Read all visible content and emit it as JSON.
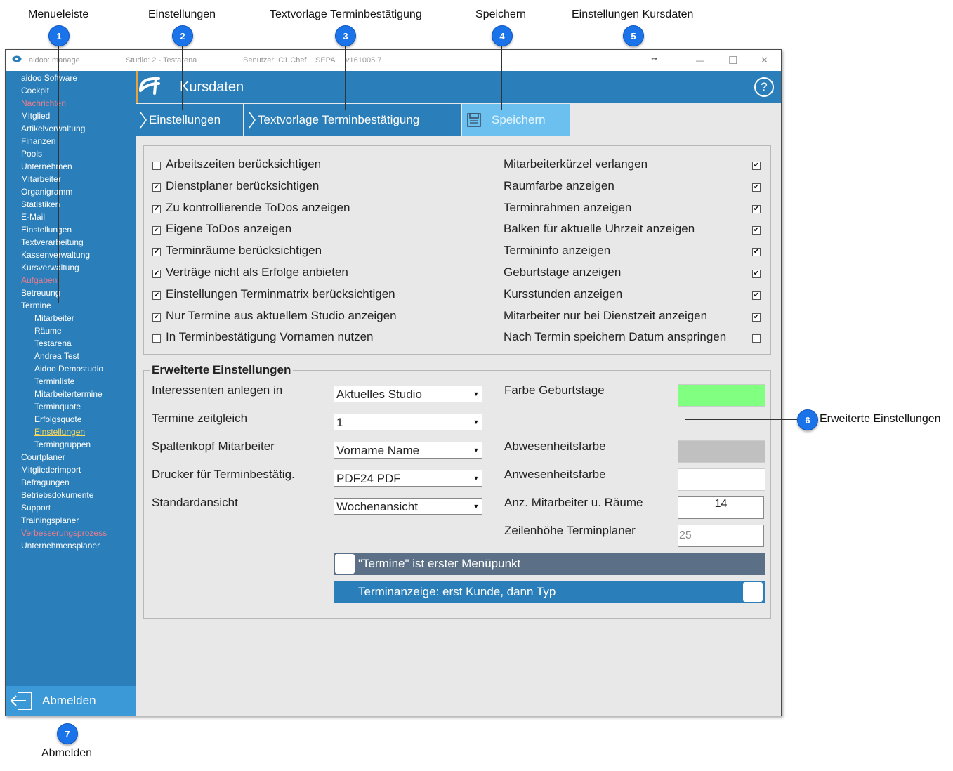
{
  "callouts": [
    {
      "num": "1",
      "label": "Menueleiste"
    },
    {
      "num": "2",
      "label": "Einstellungen"
    },
    {
      "num": "3",
      "label": "Textvorlage Terminbestätigung"
    },
    {
      "num": "4",
      "label": "Speichern"
    },
    {
      "num": "5",
      "label": "Einstellungen Kursdaten"
    },
    {
      "num": "6",
      "label": "Erweiterte Einstellungen"
    },
    {
      "num": "7",
      "label": "Abmelden"
    }
  ],
  "titlebar": {
    "app": "aidoo::manage",
    "studio": "Studio: 2 - Testarena",
    "user": "Benutzer: C1 Chef",
    "sepa": "SEPA",
    "version": "v161005.7",
    "resize_glyph": "↔",
    "min_glyph": "—",
    "max_glyph": "☐",
    "close_glyph": "✕"
  },
  "sidebar": {
    "items": [
      {
        "label": "aidoo Software",
        "style": "normal"
      },
      {
        "label": "Cockpit",
        "style": "normal"
      },
      {
        "label": "Nachrichten",
        "style": "red"
      },
      {
        "label": "Mitglied",
        "style": "normal"
      },
      {
        "label": "Artikelverwaltung",
        "style": "normal"
      },
      {
        "label": "Finanzen",
        "style": "normal"
      },
      {
        "label": "Pools",
        "style": "normal"
      },
      {
        "label": "Unternehmen",
        "style": "normal"
      },
      {
        "label": "Mitarbeiter",
        "style": "normal"
      },
      {
        "label": "Organigramm",
        "style": "normal"
      },
      {
        "label": "Statistiken",
        "style": "normal"
      },
      {
        "label": "E-Mail",
        "style": "normal"
      },
      {
        "label": "Einstellungen",
        "style": "normal"
      },
      {
        "label": "Textverarbeitung",
        "style": "normal"
      },
      {
        "label": "Kassenverwaltung",
        "style": "normal"
      },
      {
        "label": "Kursverwaltung",
        "style": "normal"
      },
      {
        "label": "Aufgaben",
        "style": "red"
      },
      {
        "label": "Betreuung",
        "style": "normal"
      },
      {
        "label": "Termine",
        "style": "normal"
      },
      {
        "label": "Mitarbeiter",
        "style": "sub"
      },
      {
        "label": "Räume",
        "style": "sub"
      },
      {
        "label": "Testarena",
        "style": "sub"
      },
      {
        "label": "Andrea Test",
        "style": "sub"
      },
      {
        "label": "Aidoo Demostudio",
        "style": "sub"
      },
      {
        "label": "Terminliste",
        "style": "sub"
      },
      {
        "label": "Mitarbeitertermine",
        "style": "sub"
      },
      {
        "label": "Terminquote",
        "style": "sub"
      },
      {
        "label": "Erfolgsquote",
        "style": "sub"
      },
      {
        "label": "Einstellungen",
        "style": "sub-active"
      },
      {
        "label": "Termingruppen",
        "style": "sub"
      },
      {
        "label": "Courtplaner",
        "style": "normal"
      },
      {
        "label": "Mitgliederimport",
        "style": "normal"
      },
      {
        "label": "Befragungen",
        "style": "normal"
      },
      {
        "label": "Betriebsdokumente",
        "style": "normal"
      },
      {
        "label": "Support",
        "style": "normal"
      },
      {
        "label": "Trainingsplaner",
        "style": "normal"
      },
      {
        "label": "Verbesserungsprozess",
        "style": "red"
      },
      {
        "label": "Unternehmensplaner",
        "style": "normal"
      }
    ],
    "logout_label": "Abmelden"
  },
  "header": {
    "title": "Kursdaten",
    "help": "?"
  },
  "tabs": {
    "einstellungen": "Einstellungen",
    "textvorlage": "Textvorlage Terminbestätigung",
    "speichern": "Speichern"
  },
  "checks_left": [
    {
      "label": "Arbeitszeiten berücksichtigen",
      "checked": false
    },
    {
      "label": "Dienstplaner berücksichtigen",
      "checked": true
    },
    {
      "label": "Zu kontrollierende ToDos anzeigen",
      "checked": true
    },
    {
      "label": "Eigene ToDos anzeigen",
      "checked": true
    },
    {
      "label": "Terminräume berücksichtigen",
      "checked": true
    },
    {
      "label": "Verträge nicht als Erfolge anbieten",
      "checked": true
    },
    {
      "label": "Einstellungen Terminmatrix berücksichtigen",
      "checked": true
    },
    {
      "label": "Nur Termine aus aktuellem Studio anzeigen",
      "checked": true
    },
    {
      "label": "In Terminbestätigung Vornamen nutzen",
      "checked": false
    }
  ],
  "checks_right": [
    {
      "label": "Mitarbeiterkürzel verlangen",
      "checked": true
    },
    {
      "label": "Raumfarbe anzeigen",
      "checked": true
    },
    {
      "label": "Terminrahmen anzeigen",
      "checked": true
    },
    {
      "label": "Balken für aktuelle Uhrzeit anzeigen",
      "checked": true
    },
    {
      "label": "Termininfo anzeigen",
      "checked": true
    },
    {
      "label": "Geburtstage anzeigen",
      "checked": true
    },
    {
      "label": "Kursstunden anzeigen",
      "checked": true
    },
    {
      "label": "Mitarbeiter nur bei Dienstzeit anzeigen",
      "checked": true
    },
    {
      "label": "Nach Termin speichern Datum anspringen",
      "checked": false
    }
  ],
  "advanced": {
    "title": "Erweiterte Einstellungen",
    "selects": [
      {
        "label": "Interessenten anlegen in",
        "value": "Aktuelles Studio"
      },
      {
        "label": "Termine zeitgleich",
        "value": "1"
      },
      {
        "label": "Spaltenkopf Mitarbeiter",
        "value": "Vorname Name"
      },
      {
        "label": "Drucker für Terminbestätig.",
        "value": "PDF24 PDF"
      },
      {
        "label": "Standardansicht",
        "value": "Wochenansicht"
      }
    ],
    "colors": [
      {
        "label": "Farbe Geburtstage",
        "color": "#80ff80"
      },
      {
        "label": "Abwesenheitsfarbe",
        "color": "#c0c0c0"
      },
      {
        "label": "Anwesenheitsfarbe",
        "color": "#ffffff"
      }
    ],
    "anz_label": "Anz. Mitarbeiter u. Räume",
    "anz_value": "14",
    "zeile_label": "Zeilenhöhe Terminplaner",
    "zeile_value": "25",
    "toggle1_label": "\"Termine\" ist erster Menüpunkt",
    "toggle2_label": "Terminanzeige: erst Kunde, dann Typ"
  },
  "colors": {
    "accent": "#2a7fba",
    "save_tab": "#6cc0f0",
    "toggle1_bg": "#5b6f87",
    "toggle2_bg": "#2a7fba",
    "badge": "#1a73e8"
  }
}
